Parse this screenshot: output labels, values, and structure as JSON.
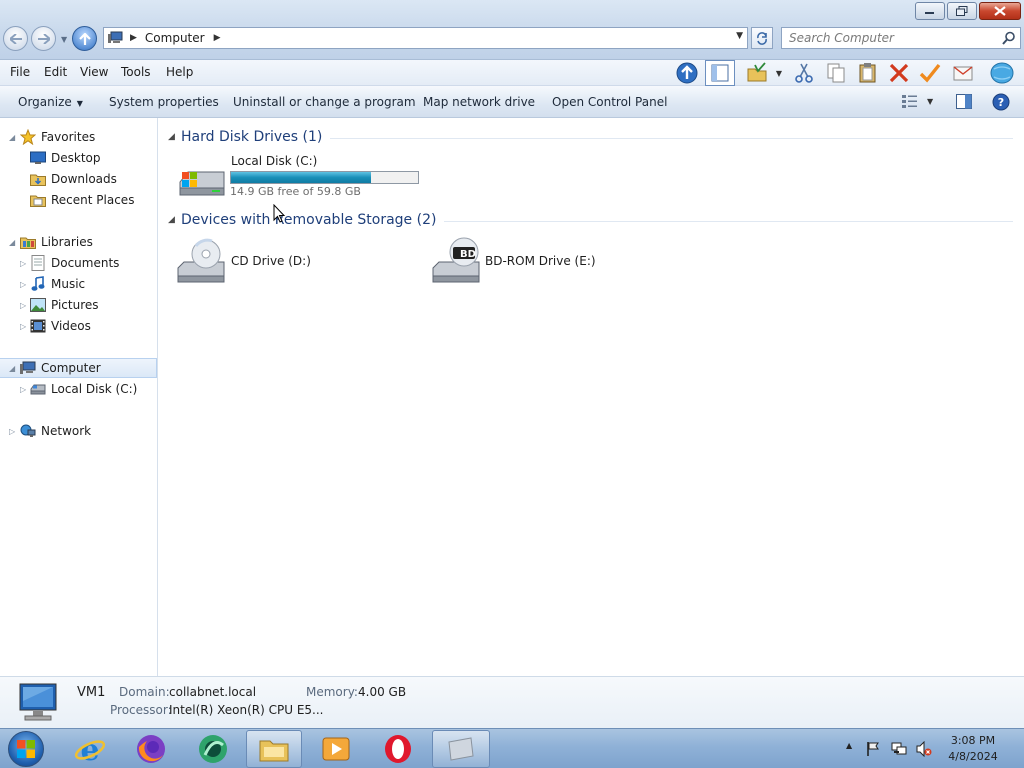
{
  "window": {
    "address": {
      "current": "Computer"
    },
    "search": {
      "placeholder": "Search Computer"
    }
  },
  "menu": [
    "File",
    "Edit",
    "View",
    "Tools",
    "Help"
  ],
  "commands": {
    "organize": "Organize",
    "system_properties": "System properties",
    "uninstall": "Uninstall or change a program",
    "map_drive": "Map network drive",
    "control_panel": "Open Control Panel"
  },
  "nav": {
    "favorites": "Favorites",
    "desktop": "Desktop",
    "downloads": "Downloads",
    "recent": "Recent Places",
    "libraries": "Libraries",
    "documents": "Documents",
    "music": "Music",
    "pictures": "Pictures",
    "videos": "Videos",
    "computer": "Computer",
    "local_disk": "Local Disk (C:)",
    "network": "Network"
  },
  "groups": {
    "hard_disks": "Hard Disk Drives (1)",
    "removable": "Devices with Removable Storage (2)"
  },
  "drives": {
    "c": {
      "name": "Local Disk (C:)",
      "capacity_text": "14.9 GB free of 59.8 GB",
      "used_fraction": 0.75
    },
    "d": {
      "name": "CD Drive (D:)"
    },
    "e": {
      "name": "BD-ROM Drive (E:)",
      "badge": "BD"
    }
  },
  "details": {
    "name": "VM1",
    "domain_label": "Domain:",
    "domain": "collabnet.local",
    "memory_label": "Memory:",
    "memory": "4.00 GB",
    "processor_label": "Processor:",
    "processor": "Intel(R) Xeon(R) CPU E5..."
  },
  "taskbar": {
    "time": "3:08 PM",
    "date": "4/8/2024"
  },
  "colors": {
    "accent": "#1f3f7a",
    "capacity_fill": "#1a8fb8",
    "selection": "#dbe8f7"
  }
}
